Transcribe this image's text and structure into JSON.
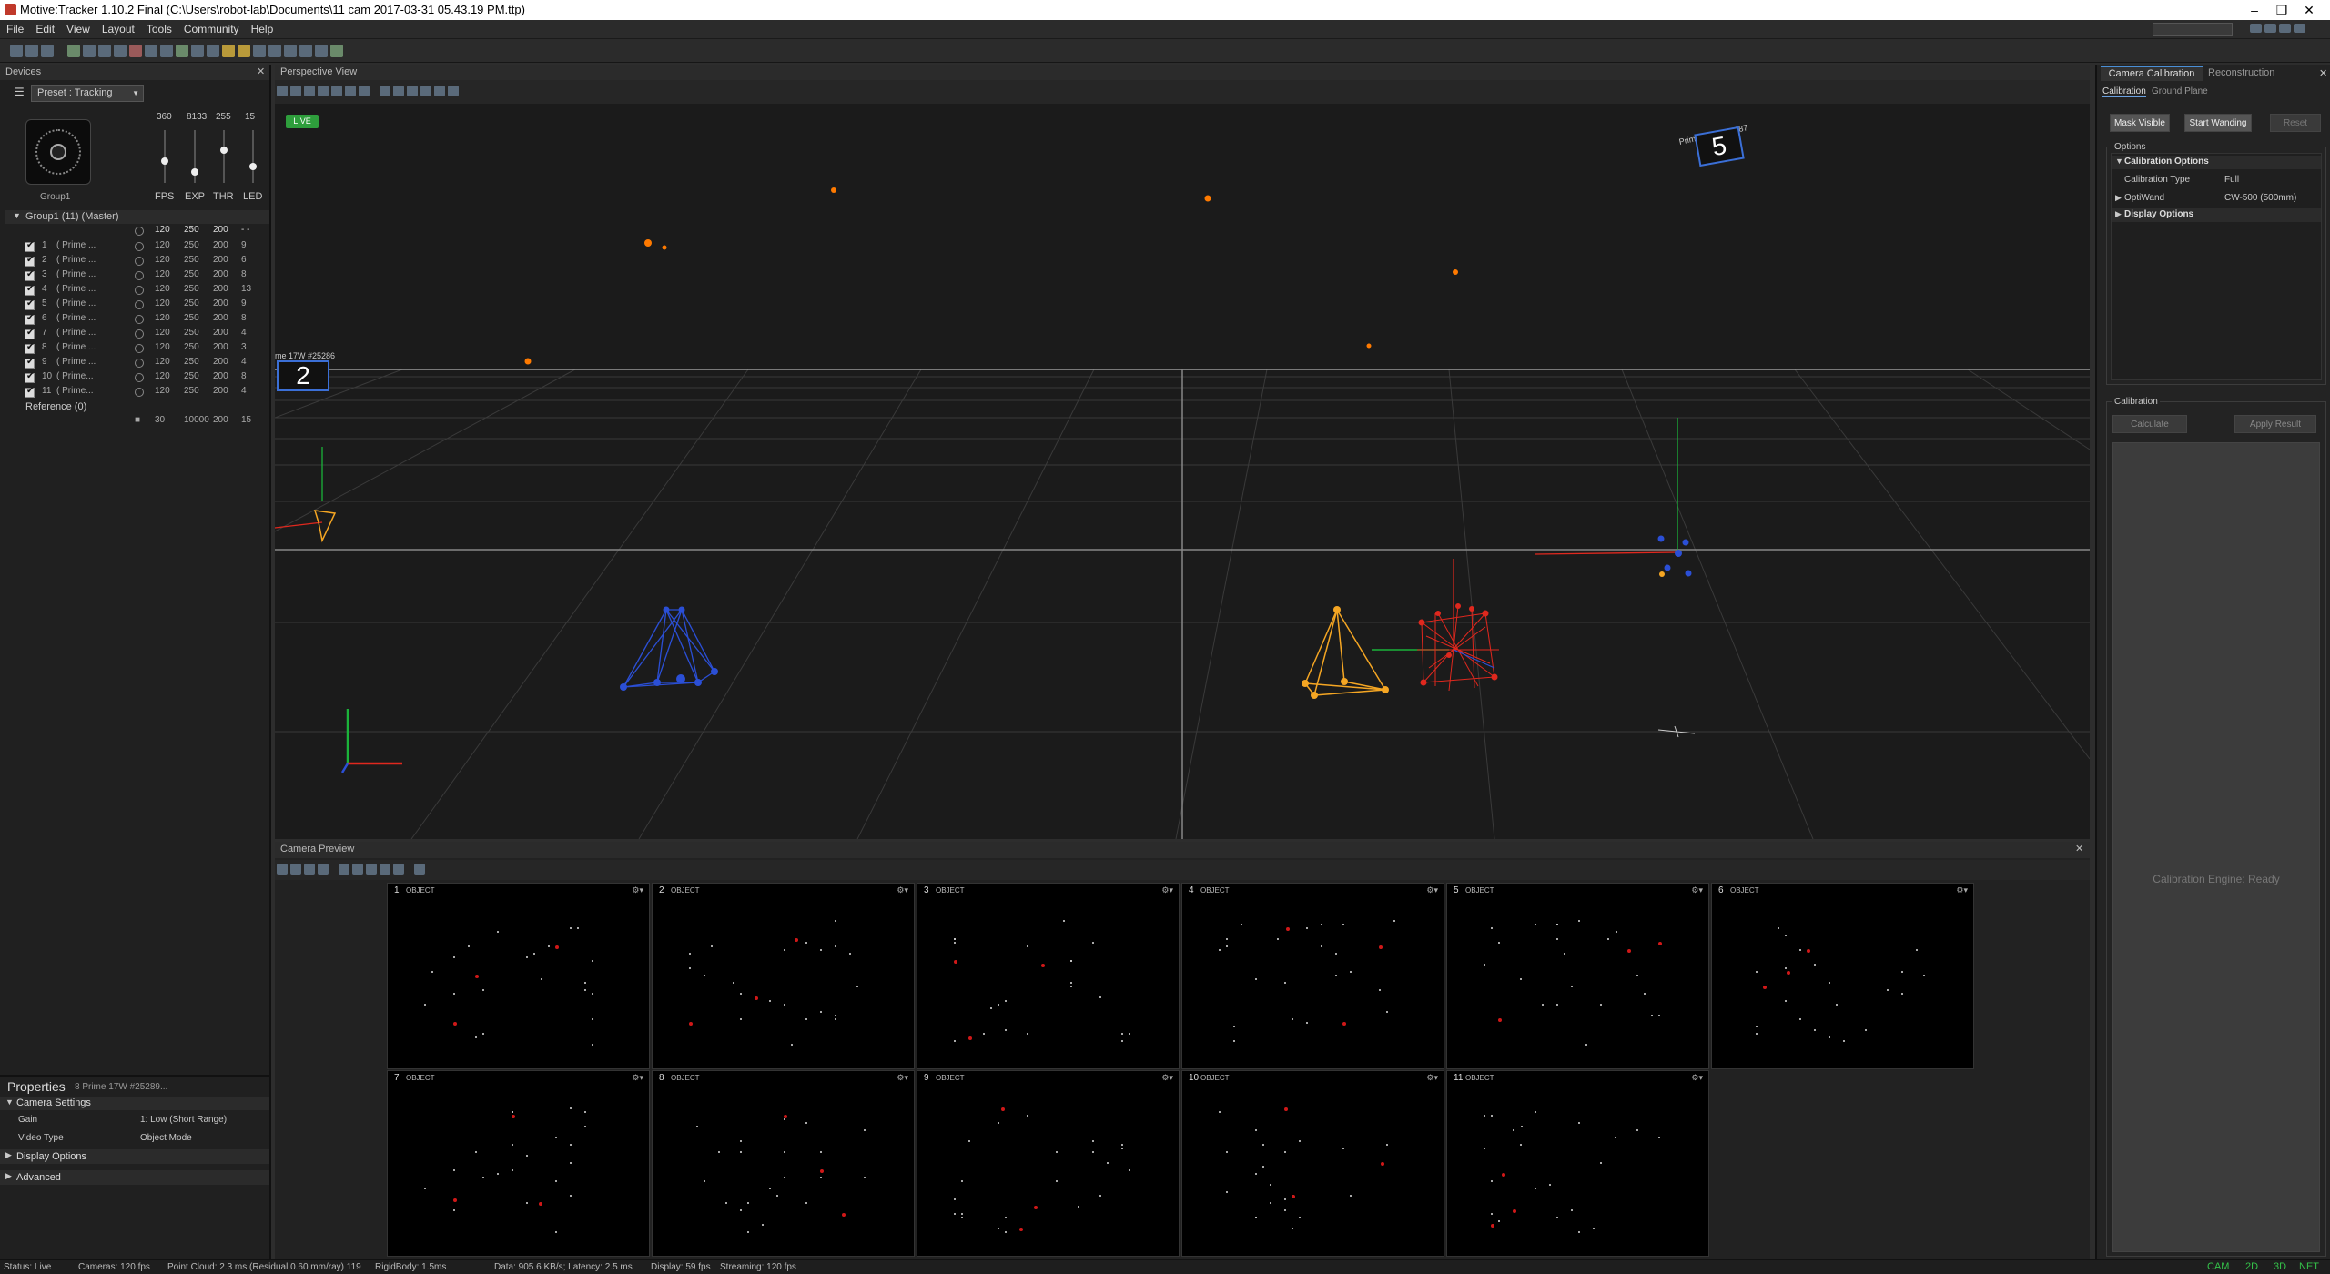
{
  "window": {
    "title": "Motive:Tracker 1.10.2 Final (C:\\Users\\robot-lab\\Documents\\11 cam 2017-03-31 05.43.19 PM.ttp)",
    "min": "–",
    "restore": "❐",
    "close": "✕"
  },
  "menu": [
    "File",
    "Edit",
    "View",
    "Layout",
    "Tools",
    "Community",
    "Help"
  ],
  "devices": {
    "title": "Devices",
    "preset": "Preset : Tracking",
    "group_label": "Group1",
    "slider_values": [
      "360",
      "8133",
      "255",
      "15"
    ],
    "slider_labels": [
      "FPS",
      "EXP",
      "THR",
      "LED"
    ],
    "group_header": "Group1 (11) (Master)",
    "group_values": [
      "120",
      "250",
      "200",
      "- -"
    ],
    "cameras": [
      {
        "id": "1",
        "name": "( Prime ...",
        "fps": "120",
        "exp": "250",
        "thr": "200",
        "led": "9"
      },
      {
        "id": "2",
        "name": "( Prime ...",
        "fps": "120",
        "exp": "250",
        "thr": "200",
        "led": "6"
      },
      {
        "id": "3",
        "name": "( Prime ...",
        "fps": "120",
        "exp": "250",
        "thr": "200",
        "led": "8"
      },
      {
        "id": "4",
        "name": "( Prime ...",
        "fps": "120",
        "exp": "250",
        "thr": "200",
        "led": "13"
      },
      {
        "id": "5",
        "name": "( Prime ...",
        "fps": "120",
        "exp": "250",
        "thr": "200",
        "led": "9"
      },
      {
        "id": "6",
        "name": "( Prime ...",
        "fps": "120",
        "exp": "250",
        "thr": "200",
        "led": "8"
      },
      {
        "id": "7",
        "name": "( Prime ...",
        "fps": "120",
        "exp": "250",
        "thr": "200",
        "led": "4"
      },
      {
        "id": "8",
        "name": "( Prime ...",
        "fps": "120",
        "exp": "250",
        "thr": "200",
        "led": "3"
      },
      {
        "id": "9",
        "name": "( Prime ...",
        "fps": "120",
        "exp": "250",
        "thr": "200",
        "led": "4"
      },
      {
        "id": "10",
        "name": "( Prime...",
        "fps": "120",
        "exp": "250",
        "thr": "200",
        "led": "8"
      },
      {
        "id": "11",
        "name": "( Prime...",
        "fps": "120",
        "exp": "250",
        "thr": "200",
        "led": "4"
      }
    ],
    "reference": "Reference (0)",
    "reference_values": [
      "30",
      "10000",
      "200",
      "15"
    ]
  },
  "properties": {
    "title": "Properties",
    "subtitle": "8 Prime 17W #25289...",
    "camera_settings": "Camera Settings",
    "gain_label": "Gain",
    "gain_value": "1: Low (Short Range)",
    "video_label": "Video Type",
    "video_value": "Object Mode",
    "display_options": "Display Options",
    "advanced": "Advanced"
  },
  "viewport": {
    "title": "Perspective View",
    "live": "LIVE",
    "cam2_label": "me 17W #25286",
    "cam2_num": "2",
    "cam5_label": "Prime 17W #25287",
    "cam5_num": "5"
  },
  "camera_preview": {
    "title": "Camera Preview",
    "close": "✕",
    "cells": [
      {
        "n": "1",
        "o": "OBJECT"
      },
      {
        "n": "2",
        "o": "OBJECT"
      },
      {
        "n": "3",
        "o": "OBJECT"
      },
      {
        "n": "4",
        "o": "OBJECT"
      },
      {
        "n": "5",
        "o": "OBJECT"
      },
      {
        "n": "6",
        "o": "OBJECT"
      },
      {
        "n": "7",
        "o": "OBJECT"
      },
      {
        "n": "8",
        "o": "OBJECT"
      },
      {
        "n": "9",
        "o": "OBJECT"
      },
      {
        "n": "10",
        "o": "OBJECT"
      },
      {
        "n": "11",
        "o": "OBJECT"
      }
    ]
  },
  "calibration": {
    "tab1": "Camera Calibration",
    "tab2": "Reconstruction",
    "close": "✕",
    "subtab1": "Calibration",
    "subtab2": "Ground Plane",
    "mask_visible": "Mask Visible",
    "start_wanding": "Start Wanding",
    "reset": "Reset",
    "options_label": "Options",
    "calibration_options": "Calibration Options",
    "calib_type_label": "Calibration Type",
    "calib_type_value": "Full",
    "optiwand_label": "OptiWand",
    "optiwand_value": "CW-500 (500mm)",
    "display_options": "Display Options",
    "calibration_label": "Calibration",
    "calculate": "Calculate",
    "apply_result": "Apply Result",
    "engine_status": "Calibration Engine: Ready"
  },
  "status": {
    "status": "Status: Live",
    "cameras": "Cameras: 120 fps",
    "point_cloud": "Point Cloud: 2.3 ms (Residual 0.60 mm/ray) 119",
    "rigid_body": "RigidBody: 1.5ms",
    "data": "Data: 905.6 KB/s; Latency: 2.5 ms",
    "display": "Display: 59 fps",
    "streaming": "Streaming: 120 fps",
    "indicators": [
      "CAM",
      "2D",
      "3D",
      "NET"
    ]
  },
  "colors": {
    "live": "#2e9e3c",
    "marker": "#ff7a00",
    "blue_body": "#2b4fd6",
    "orange_body": "#f5a623",
    "red_body": "#e0281e",
    "indicator": "#35c24a"
  }
}
